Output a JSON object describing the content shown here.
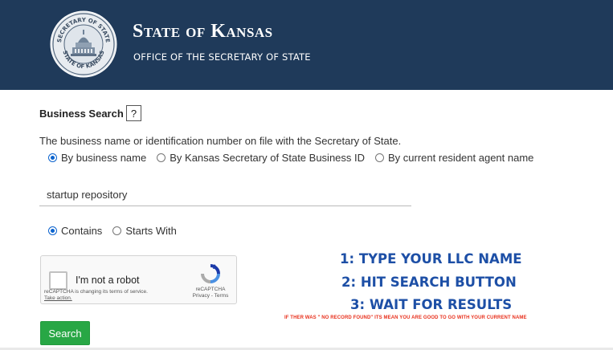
{
  "header": {
    "title": "State of Kansas",
    "subtitle": "OFFICE OF THE SECRETARY OF STATE",
    "seal_text_top": "SECRETARY OF STATE",
    "seal_text_bottom": "STATE OF KANSAS",
    "background_color": "#1f3a5a"
  },
  "search": {
    "label": "Business Search",
    "help_label": "?",
    "description": "The business name or identification number on file with the Secretary of State.",
    "search_type_options": [
      {
        "label": "By business name",
        "checked": true
      },
      {
        "label": "By Kansas Secretary of State Business ID",
        "checked": false
      },
      {
        "label": "By current resident agent name",
        "checked": false
      }
    ],
    "query_value": "startup repository",
    "match_options": [
      {
        "label": "Contains",
        "checked": true
      },
      {
        "label": "Starts With",
        "checked": false
      }
    ],
    "button_label": "Search",
    "button_color": "#28a745"
  },
  "captcha": {
    "label": "I'm not a robot",
    "notice": "reCAPTCHA is changing its terms of service.",
    "notice_link": "Take action.",
    "brand": "reCAPTCHA",
    "privacy_terms": "Privacy - Terms"
  },
  "instructions": {
    "steps": [
      "1: TYPE YOUR LLC NAME",
      "2:  HIT SEARCH BUTTON",
      "3: WAIT FOR RESULTS"
    ],
    "note": "IF THER WAS \" NO RECORD FOUND\" ITS MEAN YOU ARE GOOD TO GO WITH YOUR CURRENT NAME",
    "step_color": "#1d4fa6",
    "note_color": "#e8301c"
  }
}
